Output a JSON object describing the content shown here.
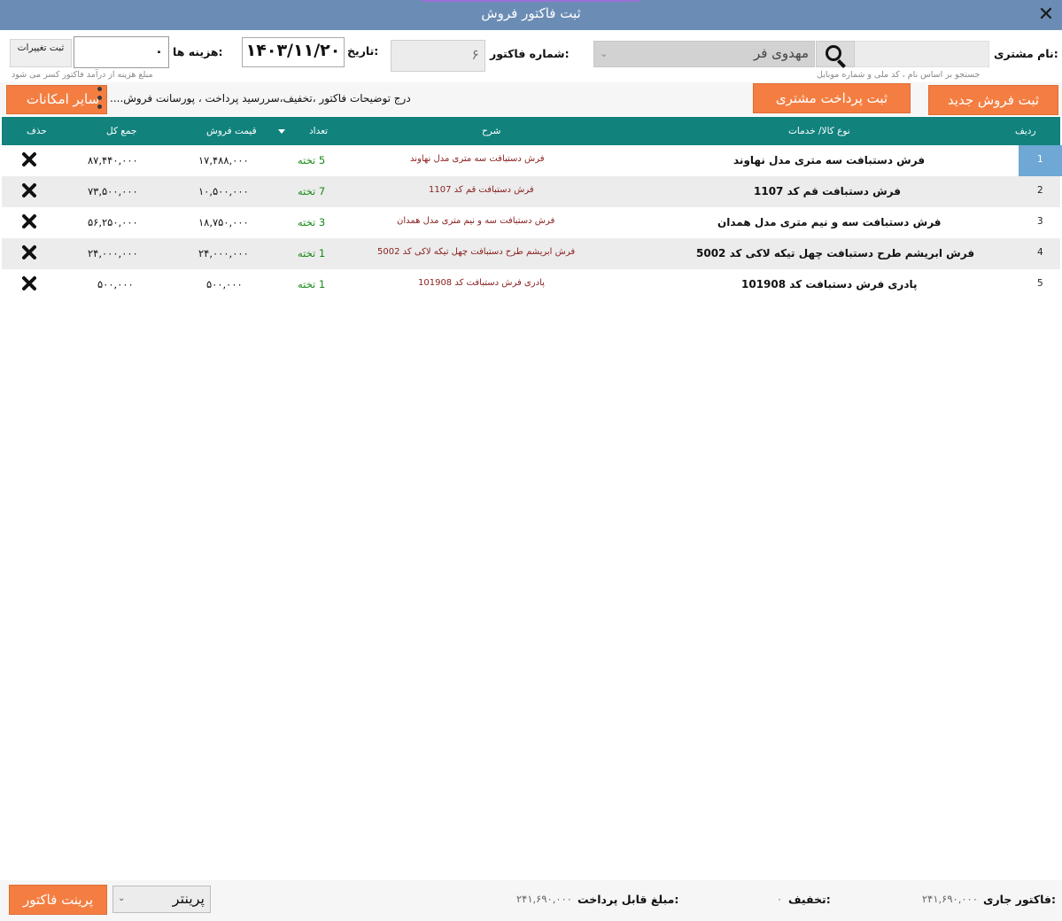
{
  "window": {
    "title": "ثبت فاکتور فروش",
    "close_glyph": "✕"
  },
  "customer": {
    "label": "نام مشتری:",
    "selected": "مهدوی فر",
    "hint": "جستجو بر اساس نام ، کد ملی و شماره موبایل"
  },
  "invoice": {
    "number_label": "شماره فاکتور:",
    "number": "۶"
  },
  "date": {
    "label": "تاریخ:",
    "value": "۱۴۰۳/۱۱/۲۰"
  },
  "cost": {
    "label": "هزینه ها:",
    "value": "۰",
    "hint": "مبلغ هزینه از درآمد فاکتور کسر می شود"
  },
  "buttons": {
    "save_changes": "ثبت تغییرات",
    "new_sale": "ثبت فروش جدید",
    "customer_payment": "ثبت پرداخت مشتری",
    "more_options": "سایر امکانات",
    "print_invoice": "پرینت فاکتور"
  },
  "description_hint": "درج توضیحات فاکتور ،تخفیف،سررسید پرداخت ، پورسانت فروش....",
  "table": {
    "headers": {
      "row": "ردیف",
      "item": "نوع کالا/ خدمات",
      "desc": "شرح",
      "qty": "تعداد",
      "price": "قیمت فروش",
      "total": "جمع کل",
      "delete": "حذف"
    },
    "rows": [
      {
        "idx": "1",
        "item": "فرش دستبافت سه متری مدل نهاوند",
        "desc": "فرش دستبافت سه متری مدل نهاوند",
        "qty": "5 تخته",
        "price": "۱۷,۴۸۸,۰۰۰",
        "total": "۸۷,۴۴۰,۰۰۰"
      },
      {
        "idx": "2",
        "item": "فرش دستبافت قم کد 1107",
        "desc": "فرش دستبافت قم کد 1107",
        "qty": "7 تخته",
        "price": "۱۰,۵۰۰,۰۰۰",
        "total": "۷۳,۵۰۰,۰۰۰"
      },
      {
        "idx": "3",
        "item": "فرش دستبافت سه و نیم متری مدل همدان",
        "desc": "فرش دستبافت سه و نیم متری مدل همدان",
        "qty": "3 تخته",
        "price": "۱۸,۷۵۰,۰۰۰",
        "total": "۵۶,۲۵۰,۰۰۰"
      },
      {
        "idx": "4",
        "item": "فرش ابریشم طرح دستبافت چهل تیکه لاکی کد 5002",
        "desc": "فرش ابریشم طرح دستبافت چهل تیکه لاکی کد 5002",
        "qty": "1 تخته",
        "price": "۲۴,۰۰۰,۰۰۰",
        "total": "۲۴,۰۰۰,۰۰۰"
      },
      {
        "idx": "5",
        "item": "پادری فرش دستبافت کد 101908",
        "desc": "پادری فرش دستبافت کد 101908",
        "qty": "1 تخته",
        "price": "۵۰۰,۰۰۰",
        "total": "۵۰۰,۰۰۰"
      }
    ]
  },
  "footer": {
    "current_label": "فاکتور جاری:",
    "current_value": "۲۴۱,۶۹۰,۰۰۰",
    "discount_label": "تخفیف:",
    "discount_value": "۰",
    "payable_label": "مبلغ قابل پرداخت:",
    "payable_value": "۲۴۱,۶۹۰,۰۰۰",
    "printer": "پرینتر"
  },
  "colors": {
    "titlebar": "#6b8db5",
    "header": "#12827d",
    "accent_button": "#f47e42",
    "selected_row": "#6fa8d4"
  }
}
